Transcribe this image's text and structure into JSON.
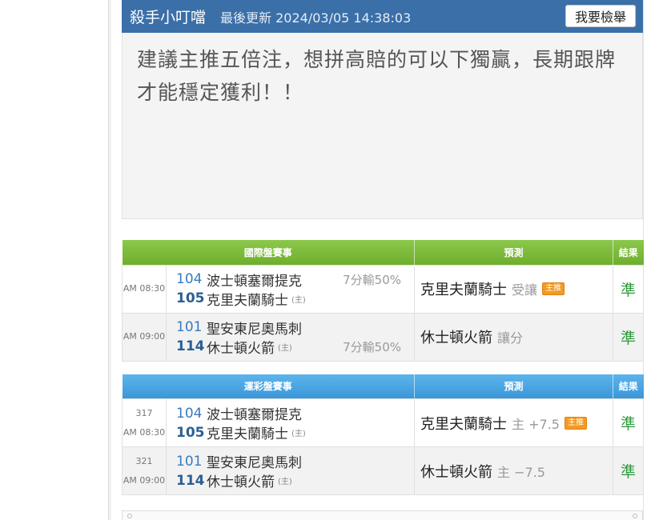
{
  "comment": {
    "author": "殺手小叮噹",
    "updated": "最後更新 2024/03/05 14:38:03",
    "report_label": "我要檢舉",
    "text": "建議主推五倍注，想拼高賠的可以下獨贏，長期跟牌才能穩定獲利！！"
  },
  "international": {
    "headers": {
      "events": "國際盤賽事",
      "prediction": "預測",
      "result": "結果"
    },
    "rows": [
      {
        "code": "",
        "time": "AM 08:30",
        "away_no": "104",
        "away_team": "波士頓塞爾提克",
        "home_no": "105",
        "home_team": "克里夫蘭騎士",
        "home_mark": "(主)",
        "odds": "7分輸50%",
        "odds_row": "away",
        "pick": "克里夫蘭騎士",
        "pick_note": "受讓",
        "badge": "主推",
        "result": "準"
      },
      {
        "code": "",
        "time": "AM 09:00",
        "away_no": "101",
        "away_team": "聖安東尼奧馬刺",
        "home_no": "114",
        "home_team": "休士頓火箭",
        "home_mark": "(主)",
        "odds": "7分輸50%",
        "odds_row": "home",
        "pick": "休士頓火箭",
        "pick_note": "讓分",
        "badge": "",
        "result": "準"
      }
    ]
  },
  "sports_lottery": {
    "headers": {
      "events": "運彩盤賽事",
      "prediction": "預測",
      "result": "結果"
    },
    "rows": [
      {
        "code": "317",
        "time": "AM 08:30",
        "away_no": "104",
        "away_team": "波士頓塞爾提克",
        "home_no": "105",
        "home_team": "克里夫蘭騎士",
        "home_mark": "(主)",
        "pick": "克里夫蘭騎士",
        "pick_note": "主 +7.5",
        "badge": "主推",
        "result": "準"
      },
      {
        "code": "321",
        "time": "AM 09:00",
        "away_no": "101",
        "away_team": "聖安東尼奧馬刺",
        "home_no": "114",
        "home_team": "休士頓火箭",
        "home_mark": "(主)",
        "pick": "休士頓火箭",
        "pick_note": "主 −7.5",
        "badge": "",
        "result": "準"
      }
    ]
  }
}
